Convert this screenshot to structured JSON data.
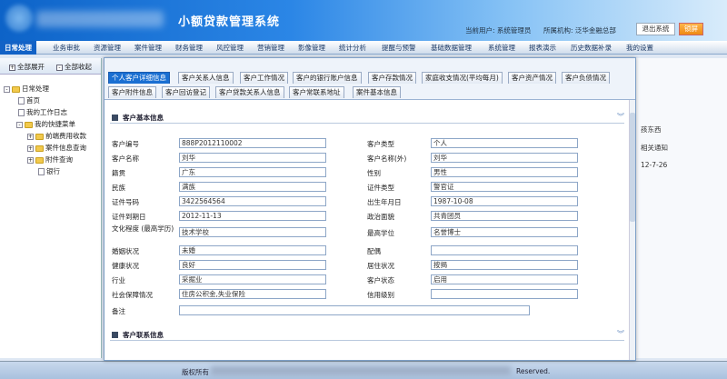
{
  "header": {
    "app_title": "小额贷款管理系统",
    "current_user": "当前用户: 系统管理员",
    "org": "所属机构: 泛华金融总部",
    "logout": "退出系统",
    "lock": "锁屏"
  },
  "menu": [
    "日常处理",
    "业务审批",
    "资源管理",
    "案件管理",
    "财务管理",
    "风控管理",
    "营销管理",
    "影像管理",
    "统计分析",
    "提醒与预警",
    "基础数据管理",
    "系统管理",
    "报表演示",
    "历史数据补录",
    "我的设置"
  ],
  "sidebar": {
    "expand_all": "全部展开",
    "collapse_all": "全部收起",
    "tree": {
      "root": "日常处理",
      "home": "首页",
      "worklog": "我的工作日志",
      "shortcuts": "我的快捷菜单",
      "items": [
        "前端费用收款",
        "案件信息查询",
        "附件查询"
      ],
      "bank": "银行"
    }
  },
  "background_notes": [
    "孩东西",
    "相关通知",
    "12-7-26"
  ],
  "tabs_row1": [
    "个人客户详细信息",
    "客户关系人信息",
    "客户工作情况",
    "客户的银行账户信息",
    "客户存款情况",
    "家庭收支情况(平均每月)",
    "客户资产情况",
    "客户负债情况"
  ],
  "tabs_row2": [
    "客户附件信息",
    "客户回访登记",
    "客户贷款关系人信息",
    "客户常联系地址",
    "案件基本信息"
  ],
  "section_basic": "客户基本信息",
  "section_contact": "客户联系信息",
  "form": {
    "customer_id_label": "客户编号",
    "customer_id": "888P2012110002",
    "customer_type_label": "客户类型",
    "customer_type": "个人",
    "name_label": "客户名称",
    "name": "刘华",
    "name_foreign_label": "客户名称(外)",
    "name_foreign": "刘华",
    "native_label": "籍贯",
    "native": "广东",
    "gender_label": "性别",
    "gender": "男性",
    "ethnic_label": "民族",
    "ethnic": "满族",
    "id_type_label": "证件类型",
    "id_type": "警官证",
    "id_no_label": "证件号码",
    "id_no": "3422564564",
    "birth_label": "出生年月日",
    "birth": "1987-10-08",
    "id_expiry_label": "证件到期日",
    "id_expiry": "2012-11-13",
    "political_label": "政治面貌",
    "political": "共青团员",
    "education_label": "文化程度 (最高学历)",
    "education": "技术学校",
    "degree_label": "最高学位",
    "degree": "名誉博士",
    "marital_label": "婚姻状况",
    "marital": "未婚",
    "spouse_label": "配偶",
    "spouse": "",
    "health_label": "健康状况",
    "health": "良好",
    "residence_label": "居住状况",
    "residence": "按揭",
    "industry_label": "行业",
    "industry": "采掘业",
    "status_label": "客户状态",
    "status": "启用",
    "social_label": "社会保障情况",
    "social": "住房公积金,失业保险",
    "credit_label": "信用级别",
    "credit": "",
    "remark_label": "备注",
    "remark": ""
  },
  "footer": {
    "left": "版权所有",
    "right": "Reserved."
  }
}
